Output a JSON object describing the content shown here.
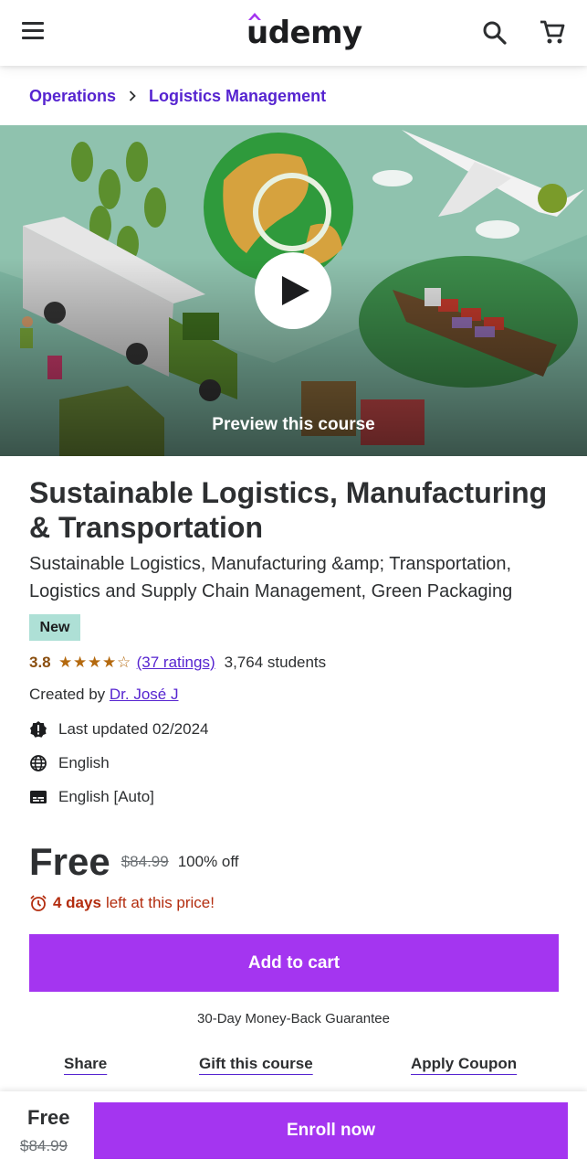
{
  "header": {
    "logo_text": "udemy",
    "menu_icon": "hamburger-menu-icon",
    "search_icon": "search-icon",
    "cart_icon": "cart-icon"
  },
  "breadcrumb": {
    "items": [
      "Operations",
      "Logistics Management"
    ],
    "separator_icon": "chevron-right-icon"
  },
  "hero": {
    "preview_label": "Preview this course",
    "play_icon": "play-icon"
  },
  "course": {
    "title": "Sustainable Logistics, Manufacturing & Transportation",
    "subtitle": "Sustainable Logistics, Manufacturing &amp; Transportation, Logistics and Supply Chain Management, Green Packaging",
    "badge": "New",
    "rating_value": "3.8",
    "rating_stars": 3.8,
    "ratings_count": "(37 ratings)",
    "students": "3,764 students",
    "created_by_label": "Created by",
    "instructor": "Dr. José J",
    "last_updated": "Last updated 02/2024",
    "language": "English",
    "captions": "English [Auto]"
  },
  "pricing": {
    "current": "Free",
    "original": "$84.99",
    "discount": "100% off",
    "countdown_bold": "4 days",
    "countdown_rest": "left at this price!",
    "add_to_cart": "Add to cart",
    "guarantee": "30-Day Money-Back Guarantee"
  },
  "actions": {
    "share": "Share",
    "gift": "Gift this course",
    "coupon": "Apply Coupon"
  },
  "bottom_bar": {
    "price": "Free",
    "original": "$84.99",
    "enroll": "Enroll now"
  },
  "colors": {
    "brand_purple": "#a435f0",
    "link_purple": "#5624d0",
    "star": "#b4690e",
    "badge_bg": "#aee0d6",
    "countdown": "#b32d0f"
  }
}
